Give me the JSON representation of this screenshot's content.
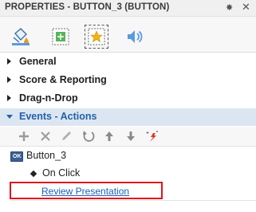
{
  "panel": {
    "title": "PROPERTIES - BUTTON_3 (BUTTON)",
    "pin_glyph": "✸",
    "close_glyph": "✕"
  },
  "tabs": [
    {
      "name": "fill-icon",
      "active": false
    },
    {
      "name": "position-icon",
      "active": false
    },
    {
      "name": "star-action-icon",
      "active": true
    },
    {
      "name": "audio-icon",
      "active": false
    }
  ],
  "sections": {
    "general": "General",
    "score_reporting": "Score & Reporting",
    "drag_n_drop": "Drag-n-Drop",
    "events_actions": "Events - Actions"
  },
  "toolbar_icons": [
    "add-icon",
    "delete-icon",
    "edit-icon",
    "undo-icon",
    "move-up-icon",
    "move-down-icon",
    "magic-icon"
  ],
  "tree": {
    "object_badge": "OK",
    "object_name": "Button_3",
    "event_name": "On Click",
    "action_name": "Review Presentation"
  },
  "colors": {
    "accent": "#2262a8",
    "highlight": "#e0141e",
    "link": "#1a5fb4",
    "events_bg": "#dce6f2"
  }
}
